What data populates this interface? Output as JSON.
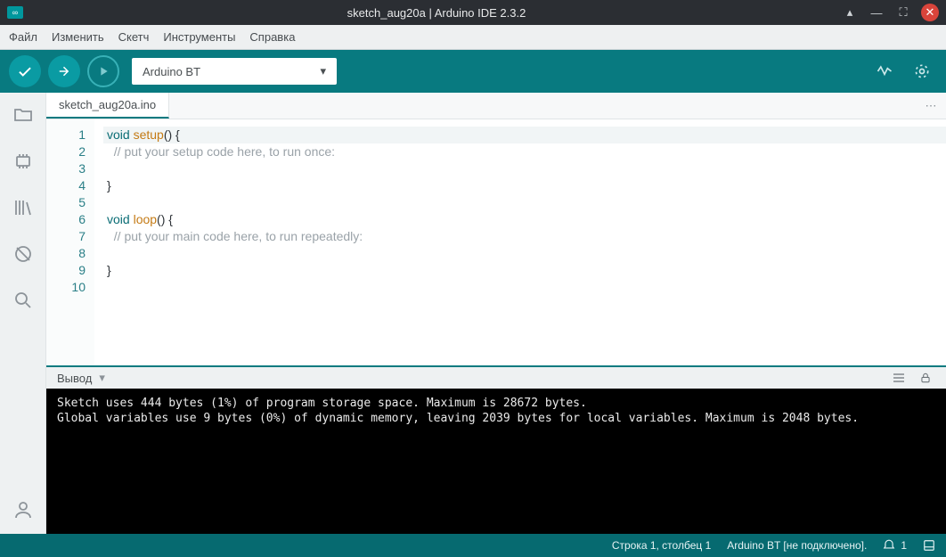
{
  "titlebar": {
    "title": "sketch_aug20a | Arduino IDE 2.3.2"
  },
  "menu": {
    "items": [
      "Файл",
      "Изменить",
      "Скетч",
      "Инструменты",
      "Справка"
    ]
  },
  "toolbar": {
    "board": "Arduino BT"
  },
  "sidebar": {
    "icons": [
      "folder-icon",
      "board-icon",
      "library-icon",
      "debug-icon",
      "search-icon"
    ],
    "bottom_icon": "user-icon"
  },
  "tabs": {
    "items": [
      "sketch_aug20a.ino"
    ]
  },
  "code": {
    "lines": [
      {
        "n": "1",
        "tokens": [
          [
            "kw",
            "void"
          ],
          [
            "sp",
            " "
          ],
          [
            "fn",
            "setup"
          ],
          [
            "txt",
            "() {"
          ]
        ]
      },
      {
        "n": "2",
        "tokens": [
          [
            "sp",
            "  "
          ],
          [
            "cm",
            "// put your setup code here, to run once:"
          ]
        ]
      },
      {
        "n": "3",
        "tokens": []
      },
      {
        "n": "4",
        "tokens": [
          [
            "txt",
            "}"
          ]
        ]
      },
      {
        "n": "5",
        "tokens": []
      },
      {
        "n": "6",
        "tokens": [
          [
            "kw",
            "void"
          ],
          [
            "sp",
            " "
          ],
          [
            "fn",
            "loop"
          ],
          [
            "txt",
            "() {"
          ]
        ]
      },
      {
        "n": "7",
        "tokens": [
          [
            "sp",
            "  "
          ],
          [
            "cm",
            "// put your main code here, to run repeatedly:"
          ]
        ]
      },
      {
        "n": "8",
        "tokens": []
      },
      {
        "n": "9",
        "tokens": [
          [
            "txt",
            "}"
          ]
        ]
      },
      {
        "n": "10",
        "tokens": []
      }
    ],
    "cursor_line": 1
  },
  "output": {
    "header": "Вывод",
    "lines": [
      "Sketch uses 444 bytes (1%) of program storage space. Maximum is 28672 bytes.",
      "Global variables use 9 bytes (0%) of dynamic memory, leaving 2039 bytes for local variables. Maximum is 2048 bytes."
    ]
  },
  "status": {
    "cursor": "Строка 1, столбец 1",
    "board": "Arduino BT [не подключено].",
    "notif_count": "1"
  }
}
